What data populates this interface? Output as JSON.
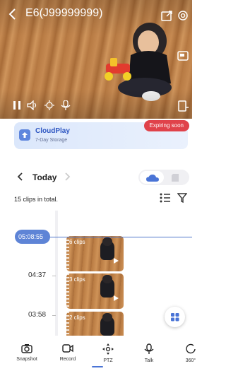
{
  "header": {
    "title": "E6(J99999999)"
  },
  "cloud": {
    "title": "CloudPlay",
    "subtitle": "7-Day Storage",
    "badge": "Expiring soon"
  },
  "day_nav": {
    "label": "Today"
  },
  "clips": {
    "count_label": "15 clips in total."
  },
  "timeline": {
    "current_time": "05:08:55",
    "labels": [
      "04:37",
      "03:58"
    ],
    "clips": [
      {
        "count": "6 clips"
      },
      {
        "count": "3 clips"
      },
      {
        "count": "2 clips"
      }
    ]
  },
  "toolbar": [
    {
      "label": "Snapshot",
      "icon": "camera-icon"
    },
    {
      "label": "Record",
      "icon": "video-record-icon"
    },
    {
      "label": "PTZ",
      "icon": "ptz-icon"
    },
    {
      "label": "Talk",
      "icon": "microphone-icon"
    },
    {
      "label": "360°",
      "icon": "rotate-360-icon"
    }
  ],
  "colors": {
    "accent": "#5e84d6",
    "badge": "#e0424a",
    "cloud_text": "#2f57c2"
  }
}
